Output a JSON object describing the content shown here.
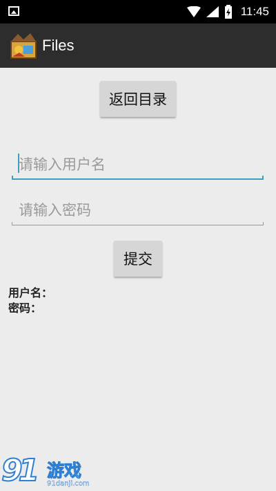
{
  "status_bar": {
    "time": "11:45"
  },
  "app_bar": {
    "title": "Files"
  },
  "back_button": {
    "label": "返回目录"
  },
  "username_field": {
    "placeholder": "请输入用户名",
    "value": ""
  },
  "password_field": {
    "placeholder": "请输入密码",
    "value": ""
  },
  "submit_button": {
    "label": "提交"
  },
  "output": {
    "username_label": "用户名：",
    "password_label": "密码："
  },
  "watermark": {
    "number": "91",
    "name": "游戏",
    "url": "91danji.com"
  },
  "colors": {
    "accent": "#3c9dbf",
    "app_bar": "#2d2d2d",
    "background": "#ececec"
  }
}
